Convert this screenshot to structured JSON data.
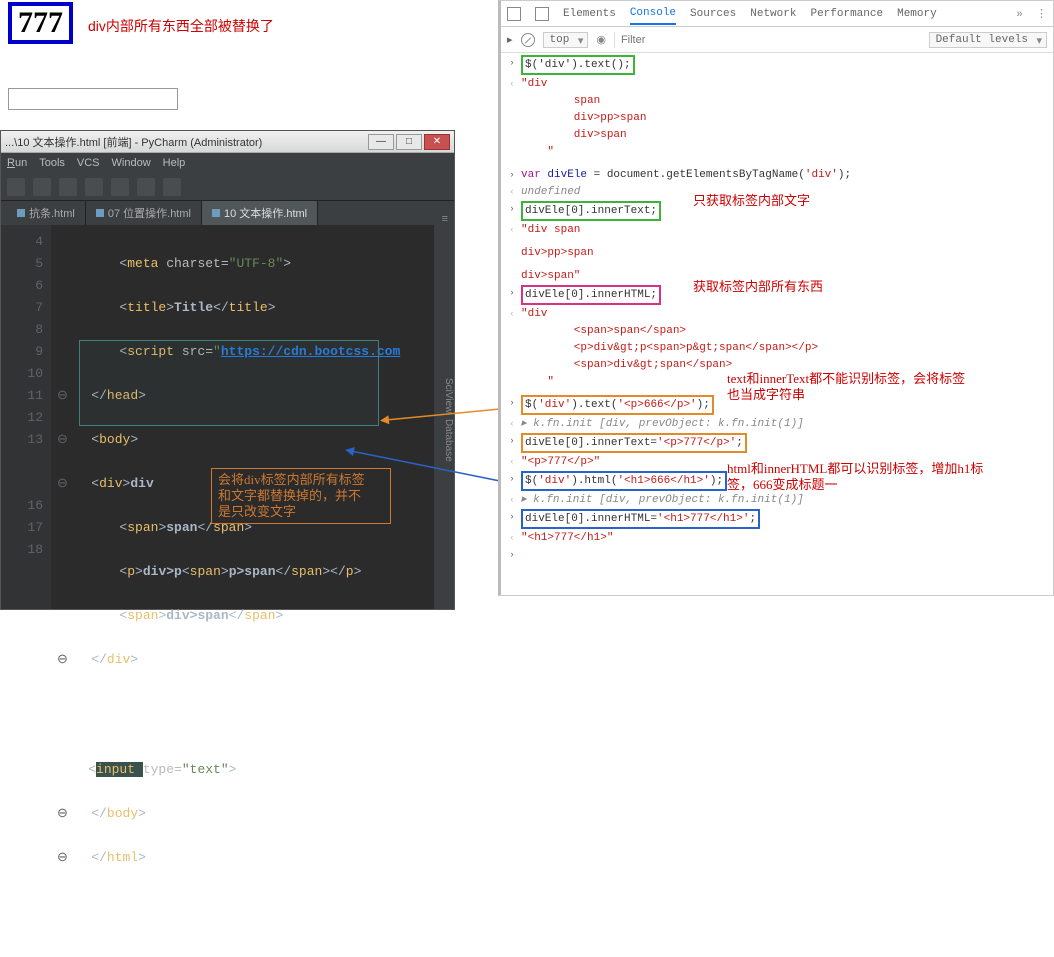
{
  "page": {
    "bigNumber": "777",
    "note1": "div内部所有东西全部被替换了"
  },
  "pycharm": {
    "title": "...\\10 文本操作.html [前端] - PyCharm (Administrator)",
    "menu": {
      "run": "Run",
      "tools": "Tools",
      "vcs": "VCS",
      "window": "Window",
      "help": "Help"
    },
    "tabs": {
      "t1": "抗条.html",
      "t2": "07 位置操作.html",
      "t3": "10 文本操作.html"
    },
    "lines": {
      "l4": "        <meta charset=\"UTF-8\">",
      "l5": "        <title>Title</title>",
      "l6": "        <script src=\"https://cdn.bootcss.com",
      "l7": "    </head>",
      "l8": "    <body>",
      "l9": "    <div>div",
      "l10": "        <span>span</span>",
      "l11": "        <p>div>p<span>p>span</span></p>",
      "l12": "        <span>div>span</span>",
      "l13": "    </div>",
      "l16": "    <input type=\"text\">",
      "l17": "    </body>",
      "l18": "    </html>"
    },
    "gutters": {
      "g4": "4",
      "g5": "5",
      "g6": "6",
      "g7": "7",
      "g8": "8",
      "g9": "9",
      "g10": "10",
      "g11": "11",
      "g12": "12",
      "g13": "13",
      "g16": "16",
      "g17": "17",
      "g18": "18"
    },
    "annotation": "会将div标签内部所有标签\n和文字都替换掉的，并不\n是只改变文字",
    "rail1": "SciView",
    "rail2": "Database"
  },
  "devtools": {
    "tabs": {
      "elements": "Elements",
      "console": "Console",
      "sources": "Sources",
      "network": "Network",
      "performance": "Performance",
      "memory": "Memory"
    },
    "toolbar": {
      "context": "top",
      "filterPlaceholder": "Filter",
      "levels": "Default levels"
    },
    "lines": {
      "c1": "$('div').text();",
      "c2": "\"div",
      "c3": "        span",
      "c4": "        div>pp>span",
      "c5": "        div>span",
      "c6": "    \"",
      "c7": "var divEle = document.getElementsByTagName('div');",
      "c8": "undefined",
      "c9": "divEle[0].innerText;",
      "c10": "\"div span",
      "c11": "div>pp>span",
      "c12": "div>span\"",
      "c13": "divEle[0].innerHTML;",
      "c14": "\"div",
      "c15": "        <span>span</span>",
      "c16": "        <p>div&gt;p<span>p&gt;span</span></p>",
      "c17": "        <span>div&gt;span</span>",
      "c18": "    \"",
      "c19": "$('div').text('<p>666</p>');",
      "c20": "▸ k.fn.init [div, prevObject: k.fn.init(1)]",
      "c21": "divEle[0].innerText='<p>777</p>';",
      "c22": "\"<p>777</p>\"",
      "c23": "$('div').html('<h1>666</h1>');",
      "c24": "▸ k.fn.init [div, prevObject: k.fn.init(1)]",
      "c25": "divEle[0].innerHTML='<h1>777</h1>';",
      "c26": "\"<h1>777</h1>\""
    },
    "notes": {
      "n1": "只获取标签内部文字",
      "n2": "获取标签内部所有东西",
      "n3": "text和innerText都不能识别标签，会将标签\n也当成字符串",
      "n4": "html和innerHTML都可以识别标签，增加h1标\n签，666变成标题一"
    }
  }
}
